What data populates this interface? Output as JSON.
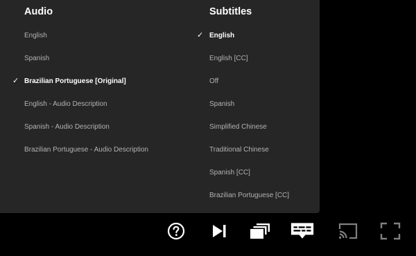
{
  "audio": {
    "heading": "Audio",
    "options": [
      {
        "label": "English",
        "selected": false
      },
      {
        "label": "Spanish",
        "selected": false
      },
      {
        "label": "Brazilian Portuguese [Original]",
        "selected": true
      },
      {
        "label": "English - Audio Description",
        "selected": false
      },
      {
        "label": "Spanish - Audio Description",
        "selected": false
      },
      {
        "label": "Brazilian Portuguese - Audio Description",
        "selected": false
      }
    ]
  },
  "subtitles": {
    "heading": "Subtitles",
    "options": [
      {
        "label": "English",
        "selected": true
      },
      {
        "label": "English [CC]",
        "selected": false
      },
      {
        "label": "Off",
        "selected": false
      },
      {
        "label": "Spanish",
        "selected": false
      },
      {
        "label": "Simplified Chinese",
        "selected": false
      },
      {
        "label": "Traditional Chinese",
        "selected": false
      },
      {
        "label": "Spanish [CC]",
        "selected": false
      },
      {
        "label": "Brazilian Portuguese [CC]",
        "selected": false
      }
    ]
  },
  "check_mark": "✓",
  "controls": [
    {
      "icon": "help-icon",
      "active": true
    },
    {
      "icon": "next-episode-icon",
      "active": true
    },
    {
      "icon": "episodes-icon",
      "active": true
    },
    {
      "icon": "subtitles-icon",
      "active": true
    },
    {
      "icon": "cast-icon",
      "active": false
    },
    {
      "icon": "fullscreen-icon",
      "active": false
    }
  ],
  "colors": {
    "panel_background": "#262626",
    "page_background": "#000000",
    "text_selected": "#ffffff",
    "text_default": "#b3b3b3",
    "icon_active": "#ffffff",
    "icon_inactive": "#808080"
  }
}
